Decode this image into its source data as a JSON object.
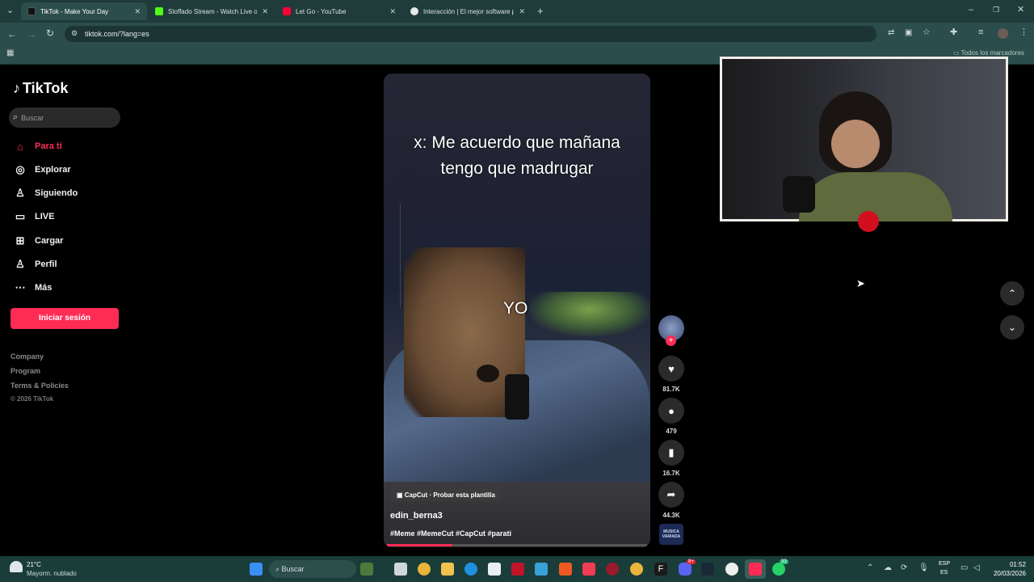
{
  "browser": {
    "tabs": [
      {
        "title": "TikTok - Make Your Day",
        "favicon_color": "#111111",
        "active": true
      },
      {
        "title": "Stoffado Stream - Watch Live o",
        "favicon_color": "#53fc18",
        "active": false
      },
      {
        "title": "Let Go - YouTube",
        "favicon_color": "#ff0033",
        "active": false
      },
      {
        "title": "Interacción | El mejor software p",
        "favicon_color": "#e8e8e8",
        "active": false
      }
    ],
    "new_tab": "+",
    "url": "tiktok.com/?lang=es",
    "bookmarks_label": "Todos los marcadores"
  },
  "tiktok": {
    "logo": "TikTok",
    "search_placeholder": "Buscar",
    "nav": [
      {
        "label": "Para ti",
        "icon": "home-icon",
        "active": true
      },
      {
        "label": "Explorar",
        "icon": "compass-icon",
        "active": false
      },
      {
        "label": "Siguiendo",
        "icon": "following-icon",
        "active": false
      },
      {
        "label": "LIVE",
        "icon": "live-icon",
        "active": false
      },
      {
        "label": "Cargar",
        "icon": "upload-icon",
        "active": false
      },
      {
        "label": "Perfil",
        "icon": "profile-icon",
        "active": false
      },
      {
        "label": "Más",
        "icon": "more-icon",
        "active": false
      }
    ],
    "login_button": "Iniciar sesión",
    "footer": [
      "Company",
      "Program",
      "Terms & Policies"
    ],
    "copyright": "© 2026 TikTok",
    "accent": "#fe2c55"
  },
  "video": {
    "caption_line1": "x: Me acuerdo que mañana",
    "caption_line2": "tengo que madrugar",
    "overlay_label": "YO",
    "template_badge": "CapCut · Probar esta plantilla",
    "author": "edin_berna3",
    "hashtags": "#Meme #MemeCut #CapCut #parati",
    "progress": 0.25
  },
  "actions": {
    "likes": "81.7K",
    "comments": "479",
    "saves": "16.7K",
    "shares": "44.3K",
    "music_label": "MUSICA VARIADA"
  },
  "taskbar": {
    "weather_temp": "21°C",
    "weather_desc": "Mayorm. nublado",
    "search_placeholder": "Buscar",
    "lang_top": "ESP",
    "lang_bottom": "ES",
    "time": "01:52",
    "date": "20/03/2026",
    "discord_badge": "9+",
    "whatsapp_badge": "33"
  }
}
